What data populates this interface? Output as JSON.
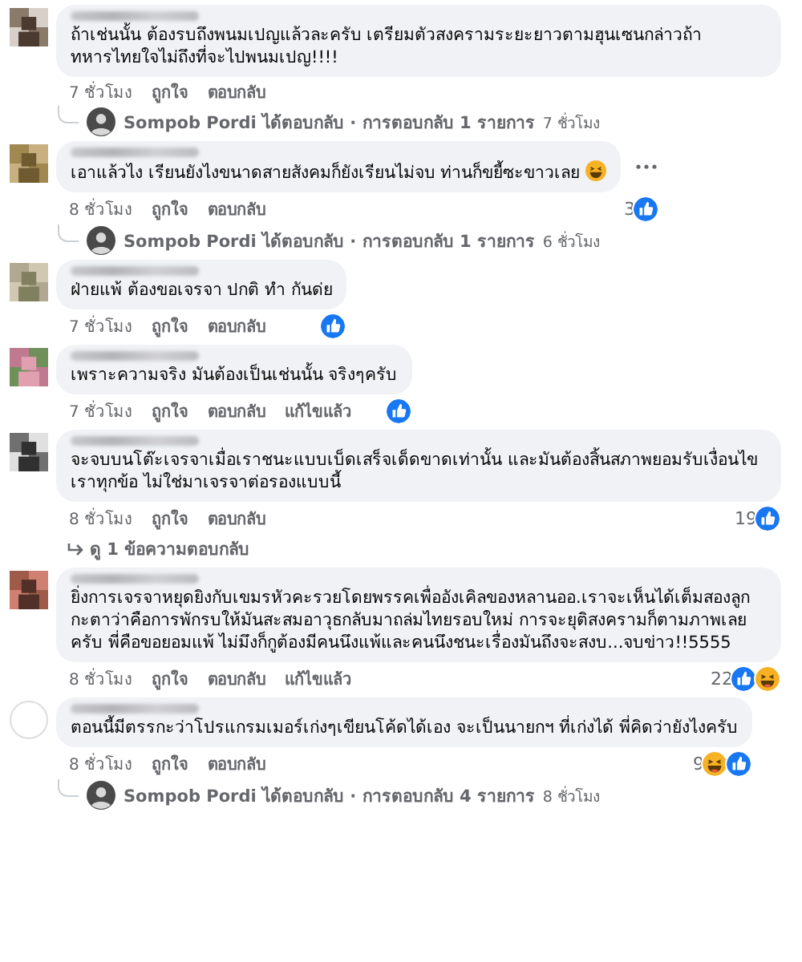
{
  "comments": [
    {
      "text": "ถ้าเช่นนั้น ต้องรบถึงพนมเปญแล้วละครับ เตรียมตัวสงครามระยะยาวตามฮุนเซนกล่าวถ้าทหารไทยใจไม่ถึงที่จะไปพนมเปญ!!!!",
      "emoji_after": false,
      "more_button": false,
      "time": "7 ชั่วโมง",
      "actions": [
        "ถูกใจ",
        "ตอบกลับ"
      ],
      "reply_summary": {
        "author": "Sompob Pordi",
        "verb": "ได้ตอบกลับ · การตอบกลับ 1 รายการ",
        "time": "7 ชั่วโมง"
      }
    },
    {
      "text": "เอาแล้วไง เรียนยังไงขนาดสายสังคมก็ยังเรียนไม่จบ ท่านก็ขยี้ซะขาวเลย",
      "emoji_after": true,
      "more_button": true,
      "time": "8 ชั่วโมง",
      "actions": [
        "ถูกใจ",
        "ตอบกลับ"
      ],
      "reactions": {
        "count": "3",
        "icons": [
          {
            "kind": "like"
          }
        ]
      },
      "reply_summary": {
        "author": "Sompob Pordi",
        "verb": "ได้ตอบกลับ · การตอบกลับ 1 รายการ",
        "time": "6 ชั่วโมง"
      }
    },
    {
      "text": "ฝ่ายแพ้ ต้องขอเจรจา ปกติ ทำ กันด่ย",
      "emoji_after": false,
      "more_button": false,
      "time": "7 ชั่วโมง",
      "actions": [
        "ถูกใจ",
        "ตอบกลับ"
      ],
      "reactions": {
        "icons": [
          {
            "kind": "like"
          }
        ]
      }
    },
    {
      "text": "เพราะความจริง มันต้องเป็นเช่นนั้น จริงๆครับ",
      "emoji_after": false,
      "more_button": false,
      "time": "7 ชั่วโมง",
      "actions": [
        "ถูกใจ",
        "ตอบกลับ",
        "แก้ไขแล้ว"
      ],
      "reactions": {
        "icons": [
          {
            "kind": "like"
          }
        ]
      }
    },
    {
      "text": "จะจบบนโต๊ะเจรจาเมื่อเราชนะแบบเบ็ดเสร็จเด็ดขาดเท่านั้น และมันต้องสิ้นสภาพยอมรับเงื่อนไขเราทุกข้อ ไม่ใช่มาเจรจาต่อรองแบบนี้",
      "emoji_after": false,
      "more_button": false,
      "time": "8 ชั่วโมง",
      "actions": [
        "ถูกใจ",
        "ตอบกลับ"
      ],
      "reactions": {
        "count": "19",
        "icons": [
          {
            "kind": "like"
          }
        ]
      },
      "view_replies": "ดู 1 ข้อความตอบกลับ"
    },
    {
      "text": "ยิ่งการเจรจาหยุดยิงกับเขมรหัวคะรวยโดยพรรคเพื่ออังเคิลของหลานออ.เราจะเห็นได้เต็มสองลูกกะตาว่าคือการพักรบให้มันสะสมอาวุธกลับมาถล่มไทยรอบใหม่ การจะยุติสงครามก็ตามภาพเลยครับ พี่คือขอยอมแพ้ ไม่มึงก็กูต้องมีคนนึงแพ้และคนนึงชนะเรื่องมันถึงจะสงบ...จบข่าว!!5555",
      "emoji_after": false,
      "more_button": false,
      "time": "8 ชั่วโมง",
      "actions": [
        "ถูกใจ",
        "ตอบกลับ",
        "แก้ไขแล้ว"
      ],
      "reactions": {
        "count": "22",
        "icons": [
          {
            "kind": "like"
          },
          {
            "kind": "haha"
          }
        ]
      }
    },
    {
      "text": "ตอนนี้มีตรรกะว่าโปรแกรมเมอร์เก่งๆเขียนโค้ดได้เอง จะเป็นนายกฯ ที่เก่งได้ พี่คิดว่ายังไงครับ",
      "emoji_after": false,
      "more_button": false,
      "time": "8 ชั่วโมง",
      "actions": [
        "ถูกใจ",
        "ตอบกลับ"
      ],
      "reactions": {
        "count": "9",
        "icons": [
          {
            "kind": "haha"
          },
          {
            "kind": "like"
          }
        ]
      },
      "reply_summary": {
        "author": "Sompob Pordi",
        "verb": "ได้ตอบกลับ · การตอบกลับ 4 รายการ",
        "time": "8 ชั่วโมง"
      }
    }
  ]
}
